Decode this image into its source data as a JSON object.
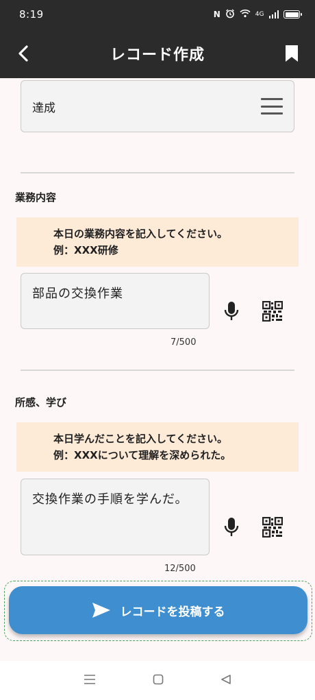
{
  "status_bar": {
    "time": "8:19",
    "nfc": "N",
    "alarm": "⏰",
    "wifi": "wifi",
    "volte": "4G"
  },
  "header": {
    "title": "レコード作成",
    "back_icon": "chevron-left-icon",
    "bookmark_icon": "bookmark-icon"
  },
  "achievement": {
    "value": "達成",
    "menu_icon": "hamburger-icon"
  },
  "work": {
    "label": "業務内容",
    "hint_line1": "本日の業務内容を記入してください。",
    "hint_line2": "例：XXX研修",
    "value": "部品の交換作業",
    "counter": "7/500"
  },
  "learning": {
    "label": "所感、学び",
    "hint_line1": "本日学んだことを記入してください。",
    "hint_line2": "例：XXXについて理解を深められた。",
    "value": "交換作業の手順を学んだ。",
    "counter": "12/500"
  },
  "submit": {
    "label": "レコードを投稿する",
    "icon": "send-icon"
  },
  "colors": {
    "app_bar": "#2b2b2b",
    "accent": "#3f8fd0",
    "hint_bg": "#fdebd8",
    "background": "#fdf7f8"
  }
}
